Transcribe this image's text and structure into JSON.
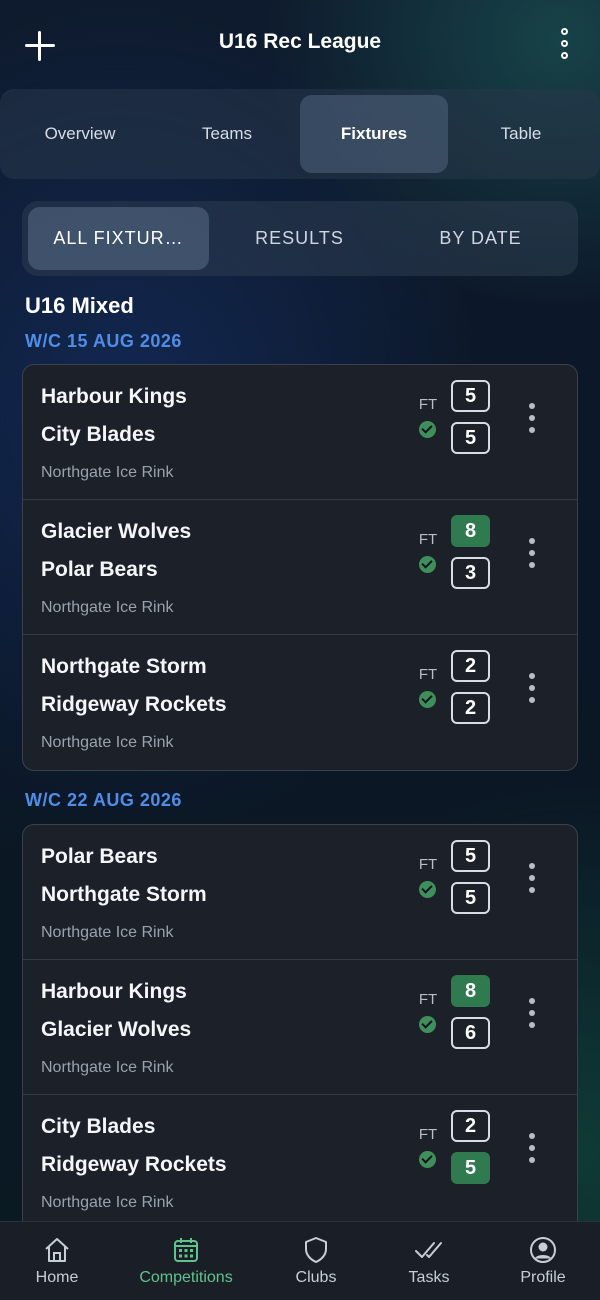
{
  "header": {
    "title": "U16 Rec League",
    "add_icon": "plus-icon",
    "menu_icon": "more-vertical-icon"
  },
  "top_tabs": [
    {
      "label": "Overview",
      "active": false
    },
    {
      "label": "Teams",
      "active": false
    },
    {
      "label": "Fixtures",
      "active": true
    },
    {
      "label": "Table",
      "active": false
    }
  ],
  "filters": [
    {
      "label": "ALL FIXTUR…",
      "active": true
    },
    {
      "label": "RESULTS",
      "active": false
    },
    {
      "label": "BY DATE",
      "active": false
    }
  ],
  "section_title": "U16 Mixed",
  "weeks": [
    {
      "label": "W/C 15 AUG 2026",
      "fixtures": [
        {
          "home": "Harbour Kings",
          "away": "City Blades",
          "venue": "Northgate Ice Rink",
          "status": "FT",
          "home_score": "5",
          "away_score": "5",
          "winner": "none"
        },
        {
          "home": "Glacier Wolves",
          "away": "Polar Bears",
          "venue": "Northgate Ice Rink",
          "status": "FT",
          "home_score": "8",
          "away_score": "3",
          "winner": "home"
        },
        {
          "home": "Northgate Storm",
          "away": "Ridgeway Rockets",
          "venue": "Northgate Ice Rink",
          "status": "FT",
          "home_score": "2",
          "away_score": "2",
          "winner": "none"
        }
      ]
    },
    {
      "label": "W/C 22 AUG 2026",
      "fixtures": [
        {
          "home": "Polar Bears",
          "away": "Northgate Storm",
          "venue": "Northgate Ice Rink",
          "status": "FT",
          "home_score": "5",
          "away_score": "5",
          "winner": "none"
        },
        {
          "home": "Harbour Kings",
          "away": "Glacier Wolves",
          "venue": "Northgate Ice Rink",
          "status": "FT",
          "home_score": "8",
          "away_score": "6",
          "winner": "home"
        },
        {
          "home": "City Blades",
          "away": "Ridgeway Rockets",
          "venue": "Northgate Ice Rink",
          "status": "FT",
          "home_score": "2",
          "away_score": "5",
          "winner": "away"
        }
      ]
    }
  ],
  "bottom_nav": [
    {
      "label": "Home",
      "icon": "home-icon",
      "active": false
    },
    {
      "label": "Competitions",
      "icon": "calendar-icon",
      "active": true
    },
    {
      "label": "Clubs",
      "icon": "shield-icon",
      "active": false
    },
    {
      "label": "Tasks",
      "icon": "double-check-icon",
      "active": false
    },
    {
      "label": "Profile",
      "icon": "user-circle-icon",
      "active": false
    }
  ],
  "colors": {
    "accent_blue": "#4f8de8",
    "win_green": "#2f7a4f",
    "active_nav": "#5fc48b",
    "card_bg": "#1b2029"
  }
}
